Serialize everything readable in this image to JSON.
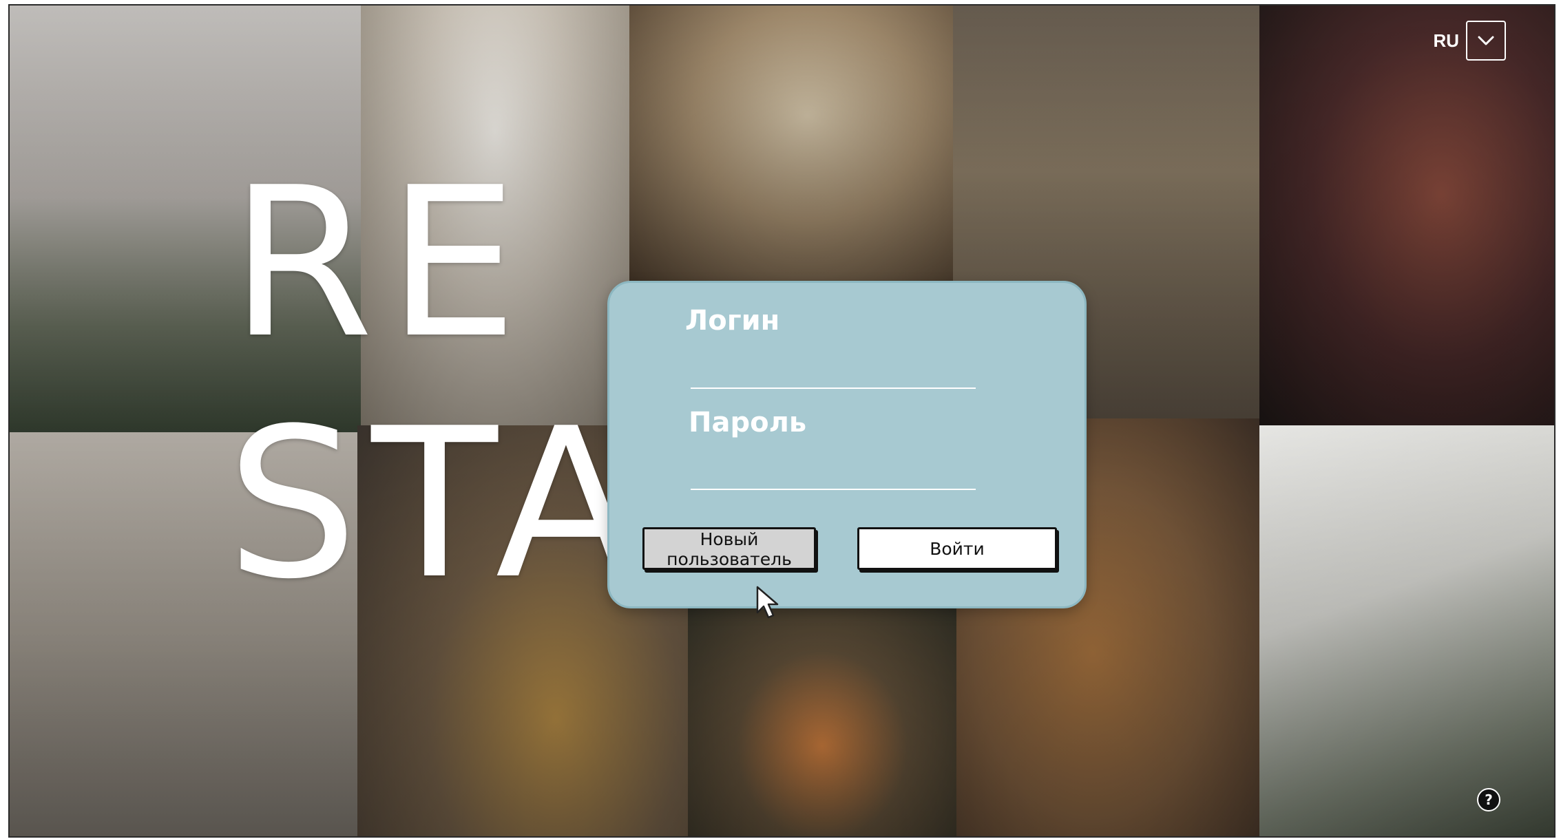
{
  "brand": {
    "line1": "RE",
    "line2": "STA"
  },
  "language": {
    "code": "RU"
  },
  "login_form": {
    "login_label": "Логин",
    "login_value": "",
    "password_label": "Пароль",
    "password_value": "",
    "new_user_button": "Новый пользователь",
    "submit_button": "Войти"
  },
  "help": {
    "label": "?"
  },
  "colors": {
    "modal_background": "#a7c9d1",
    "text_white": "#ffffff",
    "button_grey": "#d3d3d3",
    "button_white": "#ffffff"
  },
  "icons": [
    "chevron-down-icon",
    "cursor-icon",
    "help-icon"
  ]
}
